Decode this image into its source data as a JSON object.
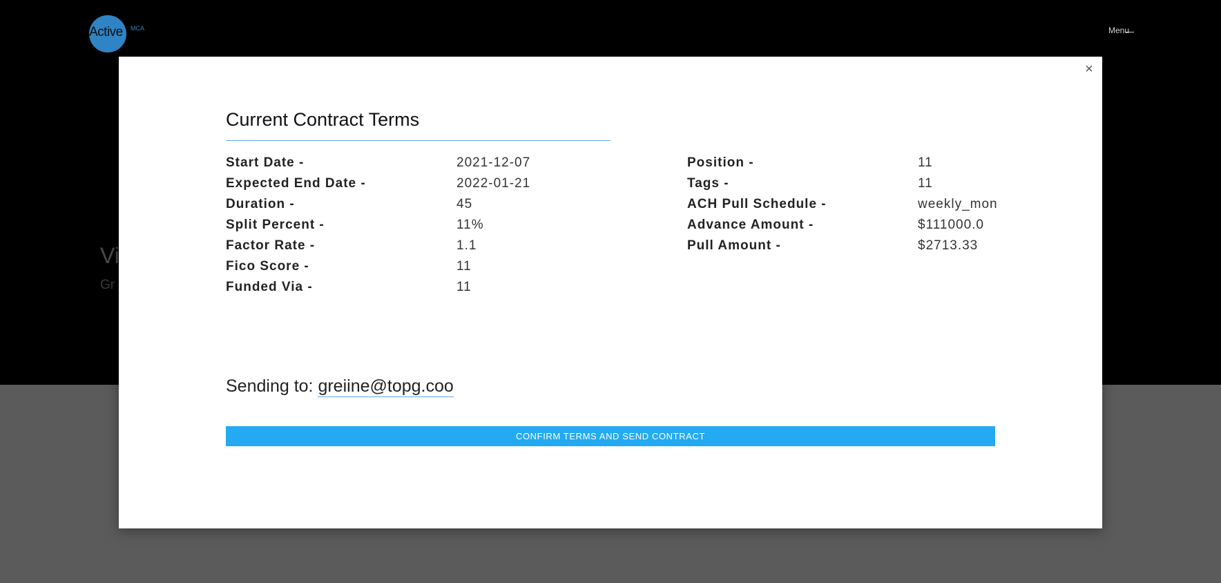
{
  "header": {
    "logo_text": "Active",
    "logo_sub": "MCA",
    "menu_label": "Menu"
  },
  "hero": {
    "title_partial": "Vi",
    "subtitle_partial": "Gr"
  },
  "modal": {
    "title": "Current Contract Terms",
    "close_symbol": "×",
    "terms_left": [
      {
        "label": "Start Date -",
        "value": "2021-12-07"
      },
      {
        "label": "Expected End Date -",
        "value": "2022-01-21"
      },
      {
        "label": "Duration -",
        "value": "45"
      },
      {
        "label": "Split Percent -",
        "value": "11%"
      },
      {
        "label": "Factor Rate -",
        "value": "1.1"
      },
      {
        "label": "Fico Score -",
        "value": "11"
      },
      {
        "label": "Funded Via -",
        "value": "11"
      }
    ],
    "terms_right": [
      {
        "label": "Position -",
        "value": "11"
      },
      {
        "label": "Tags -",
        "value": "11"
      },
      {
        "label": "ACH Pull Schedule -",
        "value": "weekly_mon"
      },
      {
        "label": "Advance Amount -",
        "value": "$111000.0"
      },
      {
        "label": "Pull Amount -",
        "value": "$2713.33"
      }
    ],
    "sending_prefix": "Sending to:",
    "sending_email": "greiine@topg.coo",
    "confirm_label": "CONFIRM TERMS AND SEND CONTRACT"
  },
  "colors": {
    "accent": "#23aaf2",
    "logo": "#3aa2f1"
  }
}
